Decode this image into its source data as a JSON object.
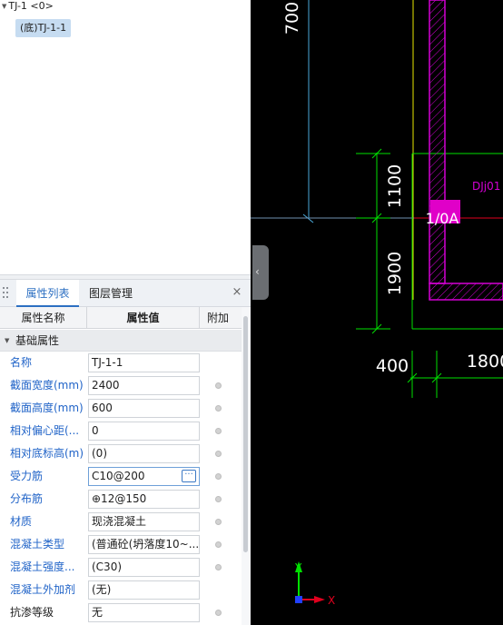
{
  "tree": {
    "root_label": "TJ-1 <0>",
    "child_label": "(底)TJ-1-1"
  },
  "panel": {
    "tab_properties": "属性列表",
    "tab_layers": "图层管理",
    "close_glyph": "×"
  },
  "grid": {
    "headers": [
      "属性名称",
      "属性值",
      "附加"
    ],
    "group_label": "基础属性",
    "rows": [
      {
        "name": "名称",
        "value": "TJ-1-1"
      },
      {
        "name": "截面宽度(mm)",
        "value": "2400"
      },
      {
        "name": "截面高度(mm)",
        "value": "600"
      },
      {
        "name": "相对偏心距(...",
        "value": "0"
      },
      {
        "name": "相对底标高(m)",
        "value": "(0)"
      },
      {
        "name": "受力筋",
        "value": "C10@200"
      },
      {
        "name": "分布筋",
        "value": "⊕12@150"
      },
      {
        "name": "材质",
        "value": "现浇混凝土"
      },
      {
        "name": "混凝土类型",
        "value": "(普通砼(坍落度10~..."
      },
      {
        "name": "混凝土强度...",
        "value": "(C30)"
      },
      {
        "name": "混凝土外加剂",
        "value": "(无)"
      },
      {
        "name": "抗渗等级",
        "value": "无"
      }
    ],
    "ellipsis_glyph": "···"
  },
  "cad": {
    "dim_700": "700",
    "dim_1100": "1100",
    "dim_1900": "1900",
    "dim_400": "400",
    "dim_1800": "1800",
    "axis_label": "1/0A",
    "element_label": "DJj01",
    "ucs_x": "X",
    "ucs_y": "Y",
    "colors": {
      "background": "#000000",
      "dimension_green": "#00e000",
      "wall_magenta": "#d400d4",
      "axis_red": "#e0001e",
      "yellow_line": "#e8e800",
      "cyan_line": "#4aa8d8"
    }
  }
}
